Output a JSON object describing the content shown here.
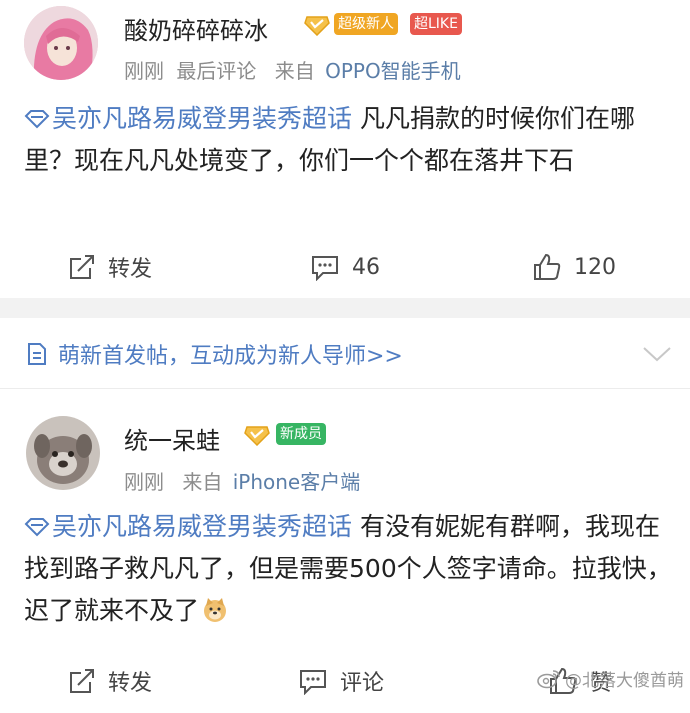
{
  "colors": {
    "topic": "#4f7cc2",
    "meta": "#8c8c8c",
    "super_newbie_badge": "#f0a623",
    "like_badge": "#e8584e",
    "newbie_badge": "#37b563",
    "separator": "#f2f2f2"
  },
  "post1": {
    "username": "酸奶碎碎碎冰",
    "badge_super_newbie": "超级新人",
    "badge_like": "超LIKE",
    "time": "刚刚",
    "last_comment": "最后评论",
    "source_prefix": "来自",
    "source": "OPPO智能手机",
    "topic": "吴亦凡路易威登男装秀超话",
    "text": " 凡凡捐款的时候你们在哪里？现在凡凡处境变了，你们一个个都在落井下石",
    "repost_label": "转发",
    "comment_count": "46",
    "like_count": "120",
    "icons": [
      "repost-icon",
      "comment-icon",
      "like-icon"
    ]
  },
  "banner": {
    "text": "萌新首发帖，互动成为新人导师>>",
    "icons": [
      "document-icon",
      "chevron-down-icon"
    ]
  },
  "post2": {
    "username": "统一呆蛙",
    "badge_newbie": "新成员",
    "time": "刚刚",
    "source_prefix": "来自",
    "source": "iPhone客户端",
    "topic": "吴亦凡路易威登男装秀超话",
    "text": "  有没有妮妮有群啊，我现在找到路子救凡凡了，但是需要500个人签字请命。拉我快，迟了就来不及了",
    "repost_label": "转发",
    "comment_label": "评论",
    "like_label": "赞",
    "icons": [
      "repost-icon",
      "comment-icon",
      "like-icon",
      "doge-emoji-icon"
    ]
  },
  "watermark": {
    "text": "@北落大傻酋萌"
  }
}
